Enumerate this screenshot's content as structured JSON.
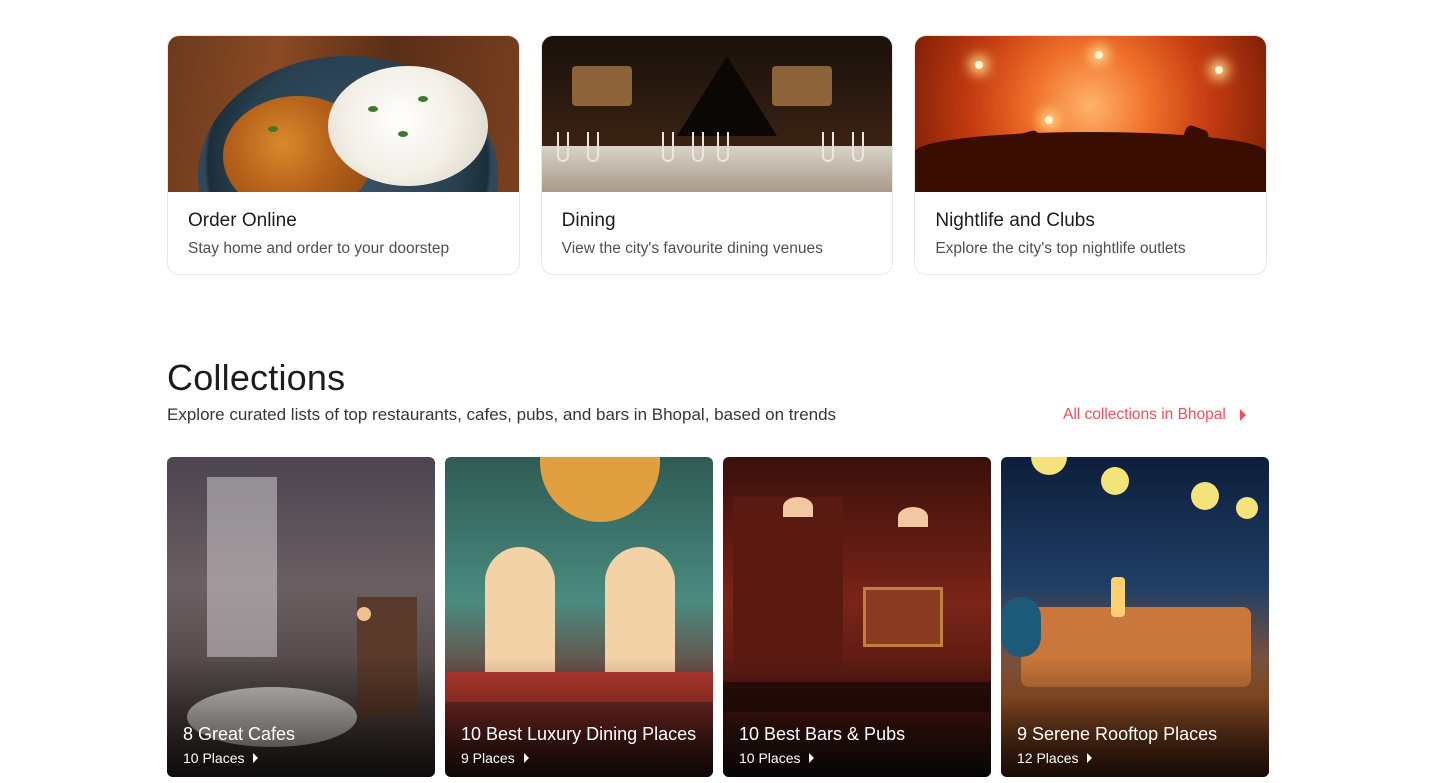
{
  "cards": [
    {
      "title": "Order Online",
      "subtitle": "Stay home and order to your doorstep"
    },
    {
      "title": "Dining",
      "subtitle": "View the city's favourite dining venues"
    },
    {
      "title": "Nightlife and Clubs",
      "subtitle": "Explore the city's top nightlife outlets"
    }
  ],
  "collections": {
    "title": "Collections",
    "subtitle": "Explore curated lists of top restaurants, cafes, pubs, and bars in Bhopal, based on trends",
    "all_link": "All collections in Bhopal",
    "items": [
      {
        "title": "8 Great Cafes",
        "count": "10 Places"
      },
      {
        "title": "10 Best Luxury Dining Places",
        "count": "9 Places"
      },
      {
        "title": "10 Best Bars & Pubs",
        "count": "10 Places"
      },
      {
        "title": "9 Serene Rooftop Places",
        "count": "12 Places"
      }
    ]
  }
}
